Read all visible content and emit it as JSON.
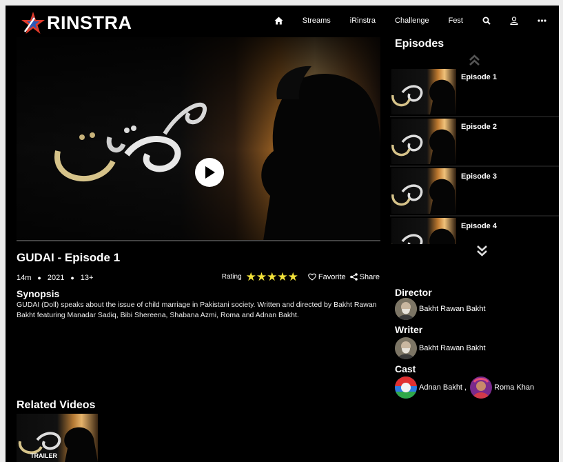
{
  "brand": {
    "name": "RINSTRA"
  },
  "nav": {
    "items": [
      {
        "key": "home",
        "label": ""
      },
      {
        "key": "streams",
        "label": "Streams"
      },
      {
        "key": "irinstra",
        "label": "iRinstra"
      },
      {
        "key": "challenge",
        "label": "Challenge"
      },
      {
        "key": "fest",
        "label": "Fest"
      }
    ],
    "icons": [
      "home-icon",
      "search-icon",
      "user-icon",
      "more-icon"
    ]
  },
  "video": {
    "title": "GUDAI - Episode 1",
    "duration": "14m",
    "year": "2021",
    "age_rating": "13+",
    "rating_label": "Rating",
    "stars": 5,
    "favorite_label": "Favorite",
    "share_label": "Share",
    "synopsis_heading": "Synopsis",
    "synopsis": "GUDAI (Doll) speaks about the issue of child marriage in Pakistani society. Written and directed by Bakht Rawan Bakht featuring Manadar Sadiq, Bibi Shereena, Shabana Azmi, Roma and Adnan Bakht."
  },
  "episodes": {
    "heading": "Episodes",
    "items": [
      "Episode 1",
      "Episode 2",
      "Episode 3",
      "Episode 4"
    ]
  },
  "credits": {
    "director_heading": "Director",
    "director": "Bakht Rawan Bakht",
    "writer_heading": "Writer",
    "writer": "Bakht Rawan Bakht",
    "cast_heading": "Cast",
    "cast": [
      "Adnan Bakht",
      "Roma Khan"
    ],
    "cast_separator": ","
  },
  "related": {
    "heading": "Related Videos",
    "badge": "TRAILER"
  },
  "colors": {
    "accent_star": "#f2e23a",
    "background": "#000000",
    "logo_red": "#e03a2a",
    "logo_blue": "#2a5ab8"
  }
}
